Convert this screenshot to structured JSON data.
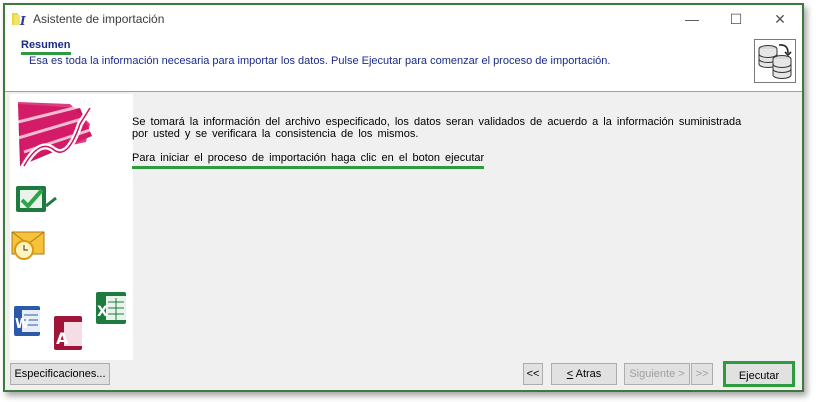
{
  "window": {
    "title": "Asistente de importación",
    "controls": {
      "minimize": "—",
      "maximize": "☐",
      "close": "✕"
    }
  },
  "header": {
    "title": "Resumen",
    "description": "Esa es toda la información necesaria para importar los datos. Pulse Ejecutar para comenzar el proceso de importación.",
    "icon": "database-transfer-icon"
  },
  "sidebar": {
    "images": [
      "chart-trend-icon",
      "excel-check-icon",
      "outlook-envelope-icon",
      "word-icon",
      "access-icon",
      "excel-icon"
    ]
  },
  "content": {
    "paragraph1": "Se tomará la información del archivo especificado, los datos seran validados de acuerdo a la información suministrada por usted y se verificara la consistencia de los mismos.",
    "paragraph2": "Para iniciar el proceso de importación haga clic en el boton ejecutar"
  },
  "buttons": {
    "specifications": "Especificaciones...",
    "first": "<<",
    "back": "< Atras",
    "next": "Siguiente >",
    "last": ">>",
    "execute": "Ejecutar"
  },
  "colors": {
    "highlight": "#2e9b3e",
    "header_text": "#1a2b8a",
    "frame": "#3e7a3e"
  }
}
